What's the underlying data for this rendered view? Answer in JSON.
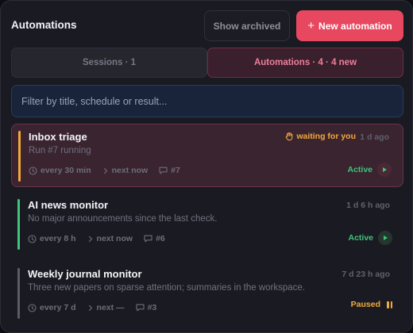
{
  "header": {
    "title": "Automations",
    "show_archived": "Show archived",
    "new_automation": "New automation",
    "new_plus": "+"
  },
  "tabs": [
    {
      "label": "Sessions · 1",
      "selected": false
    },
    {
      "label": "Automations · 4 · 4 new",
      "selected": true
    }
  ],
  "filter": {
    "placeholder": "Filter by title, schedule or result..."
  },
  "automations": [
    {
      "title": "Inbox triage",
      "summary": "Run #7 running",
      "waiting": "waiting for you",
      "ago": "1 d ago",
      "schedule": "every 30 min",
      "next": "next now",
      "runs": "#7",
      "status": "Active",
      "accent_color": "#f2a93b"
    },
    {
      "title": "AI news monitor",
      "summary": "No major announcements since the last check.",
      "ago": "1 d 6 h ago",
      "schedule": "every 8 h",
      "next": "next now",
      "runs": "#6",
      "status": "Active",
      "accent_color": "#3fc47a"
    },
    {
      "title": "Weekly journal monitor",
      "summary": "Three new papers on sparse attention; summaries in the workspace.",
      "ago": "7 d 23 h ago",
      "schedule": "every 7 d",
      "next": "next —",
      "runs": "#3",
      "status": "Paused",
      "accent_color": "#5a5c66"
    }
  ],
  "colors": {
    "brand": "#e8485f",
    "active": "#3fc47a",
    "paused": "#f2a93b",
    "background": "#1a1b22"
  },
  "icons": [
    "plus-icon",
    "hand-icon",
    "clock-icon",
    "chevron-right-icon",
    "comment-icon",
    "play-icon",
    "pause-icon"
  ]
}
